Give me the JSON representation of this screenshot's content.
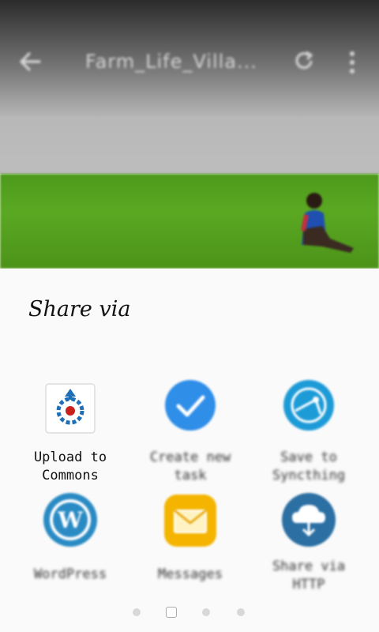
{
  "toolbar": {
    "title": "Farm_Life_Villa...",
    "back_icon": "arrow-back-icon",
    "refresh_icon": "refresh-icon",
    "more_icon": "more-vert-icon"
  },
  "sheet": {
    "title": "Share via"
  },
  "apps": [
    {
      "label": "Upload to\nCommons",
      "icon": "commons-upload-icon",
      "color": "#1e6fb8"
    },
    {
      "label": "Create new\ntask",
      "icon": "checkmark-circle-icon",
      "color": "#2f8ee8"
    },
    {
      "label": "Save to\nSyncthing",
      "icon": "syncthing-icon",
      "color": "#1d9bd7"
    },
    {
      "label": "WordPress",
      "icon": "wordpress-icon",
      "color": "#2a8bc4"
    },
    {
      "label": "Messages",
      "icon": "envelope-icon",
      "color": "#f4b400"
    },
    {
      "label": "Share via\nHTTP",
      "icon": "cloud-share-icon",
      "color": "#2b6fa3"
    }
  ],
  "pager": {
    "count": 4,
    "active_index": 1
  }
}
